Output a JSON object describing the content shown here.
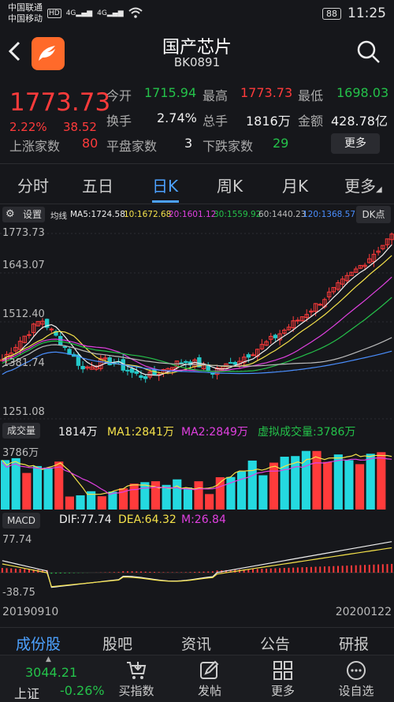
{
  "status_bar": {
    "carrier1": "中国联通",
    "carrier2": "中国移动",
    "hd": "HD",
    "net1": "4G",
    "net2": "4G",
    "battery": "88",
    "time": "11:25"
  },
  "header": {
    "title": "国产芯片",
    "code": "BK0891",
    "icons": [
      "back-icon",
      "app-logo",
      "search-icon"
    ]
  },
  "quote": {
    "price": "1773.73",
    "change_pct": "2.22%",
    "change_val": "38.52",
    "stats": [
      {
        "label": "今开",
        "value": "1715.94",
        "color": "#24c24a"
      },
      {
        "label": "最高",
        "value": "1773.73",
        "color": "#ff3b3b"
      },
      {
        "label": "最低",
        "value": "1698.03",
        "color": "#24c24a"
      },
      {
        "label": "换手",
        "value": "2.74%",
        "color": "#f0f0f0"
      },
      {
        "label": "总手",
        "value": "1816万",
        "color": "#f0f0f0"
      },
      {
        "label": "金额",
        "value": "428.78亿",
        "color": "#f0f0f0"
      },
      {
        "label": "上涨家数",
        "value": "80",
        "color": "#ff3b3b"
      },
      {
        "label": "平盘家数",
        "value": "3",
        "color": "#f0f0f0"
      },
      {
        "label": "下跌家数",
        "value": "29",
        "color": "#24c24a"
      }
    ],
    "more_button": "更多"
  },
  "tabs": [
    "分时",
    "五日",
    "日K",
    "周K",
    "月K",
    "更多"
  ],
  "active_tab": "日K",
  "kline": {
    "settings_label": "设置",
    "dk_label": "DK点",
    "ma_title": "均线",
    "ma": [
      {
        "text": "MA5:1724.58",
        "color": "#f0f0f0"
      },
      {
        "text": "10:1672.68",
        "color": "#f5e24a"
      },
      {
        "text": "20:1601.12",
        "color": "#e040e0"
      },
      {
        "text": "30:1559.92",
        "color": "#24c24a"
      },
      {
        "text": "60:1440.23",
        "color": "#bbbbbb"
      },
      {
        "text": "120:1368.57",
        "color": "#4a8fff"
      }
    ],
    "y_labels": [
      "1773.73",
      "1643.07",
      "1512.40",
      "1381.74",
      "1251.08"
    ]
  },
  "volume": {
    "label": "成交量",
    "value": "1814万",
    "ma1": "MA1:2841万",
    "ma2": "MA2:2849万",
    "virtual": "虚拟成交量:3786万",
    "axis_top": "3786万",
    "colors": {
      "ma1": "#f5e24a",
      "ma2": "#e040e0",
      "virtual": "#24c24a"
    }
  },
  "macd": {
    "label": "MACD",
    "dif": "DIF:77.74",
    "dea": "DEA:64.32",
    "m": "M:26.84",
    "axis_top": "77.74",
    "axis_bottom": "-38.75",
    "date_start": "20190910",
    "date_end": "20200122"
  },
  "bottom_tabs": [
    "成份股",
    "股吧",
    "资讯",
    "公告",
    "研报"
  ],
  "dock": {
    "index_name": "上证",
    "index_value": "3044.21",
    "index_change": "-0.26%",
    "items": [
      {
        "label": "买指数",
        "icon": "cart-icon"
      },
      {
        "label": "发帖",
        "icon": "edit-icon"
      },
      {
        "label": "更多",
        "icon": "grid-icon"
      },
      {
        "label": "设自选",
        "icon": "dots-icon"
      }
    ]
  }
}
